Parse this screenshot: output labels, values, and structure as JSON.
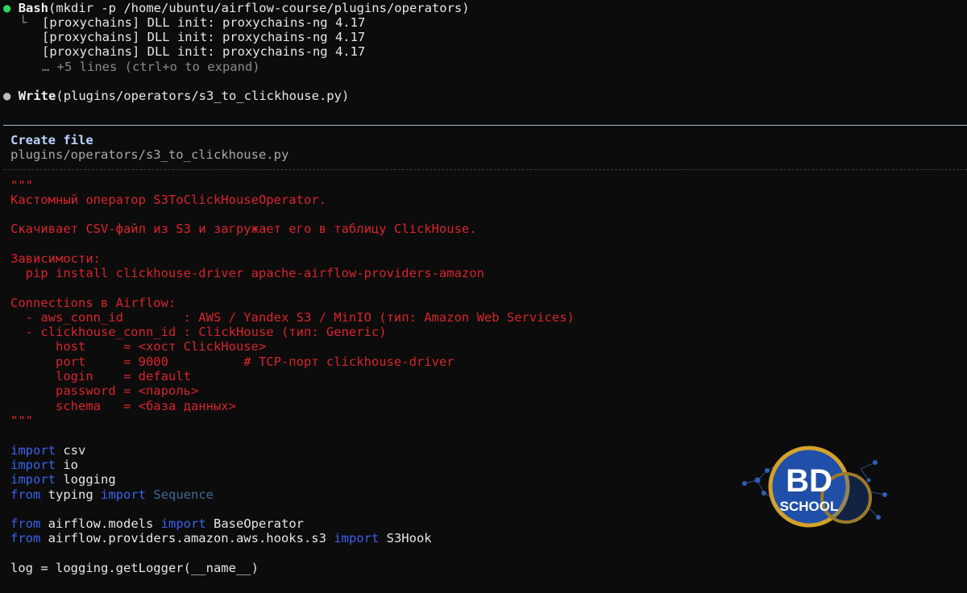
{
  "history": {
    "bash": {
      "tool": "Bash",
      "arg": "(mkdir -p /home/ubuntu/airflow-course/plugins/operators)",
      "branch": "└",
      "out1": "[proxychains] DLL init: proxychains-ng 4.17",
      "out2": "[proxychains] DLL init: proxychains-ng 4.17",
      "out3": "[proxychains] DLL init: proxychains-ng 4.17",
      "more": "… +5 lines (ctrl+o to expand)"
    },
    "write": {
      "tool": "Write",
      "arg": "(plugins/operators/s3_to_clickhouse.py)"
    }
  },
  "dialog": {
    "title": "Create file",
    "path": "plugins/operators/s3_to_clickhouse.py"
  },
  "code": {
    "doc_open": "\"\"\"",
    "doc_1": "Кастомный оператор S3ToClickHouseOperator.",
    "doc_2": "Скачивает CSV-файл из S3 и загружает его в таблицу ClickHouse.",
    "doc_3": "Зависимости:",
    "doc_4": "  pip install clickhouse-driver apache-airflow-providers-amazon",
    "doc_5": "Connections в Airflow:",
    "doc_6": "  - aws_conn_id        : AWS / Yandex S3 / MinIO (тип: Amazon Web Services)",
    "doc_7": "  - clickhouse_conn_id : ClickHouse (тип: Generic)",
    "doc_8": "      host     = <хост ClickHouse>",
    "doc_9": "      port     = 9000          # TCP-порт clickhouse-driver",
    "doc_10": "      login    = default",
    "doc_11": "      password = <пароль>",
    "doc_12": "      schema   = <база данных>",
    "doc_close": "\"\"\"",
    "kw_import": "import",
    "kw_from": "from",
    "mod_csv": "csv",
    "mod_io": "io",
    "mod_logging": "logging",
    "mod_typing": "typing",
    "name_sequence": "Sequence",
    "mod_models": "airflow.models",
    "name_baseop": "BaseOperator",
    "mod_s3": "airflow.providers.amazon.aws.hooks.s3",
    "name_s3hook": "S3Hook",
    "log_line": "log = logging.getLogger(__name__)"
  },
  "watermark": {
    "top": "BD",
    "bottom": "SCHOOL",
    "colors": {
      "ring": "#d4a22a",
      "fill": "#1f4fa8"
    }
  },
  "colors": {
    "background": "#0c0c0c",
    "docstring": "#d8242c",
    "keyword": "#3a62ee",
    "status_dot": "#2fd45c"
  }
}
